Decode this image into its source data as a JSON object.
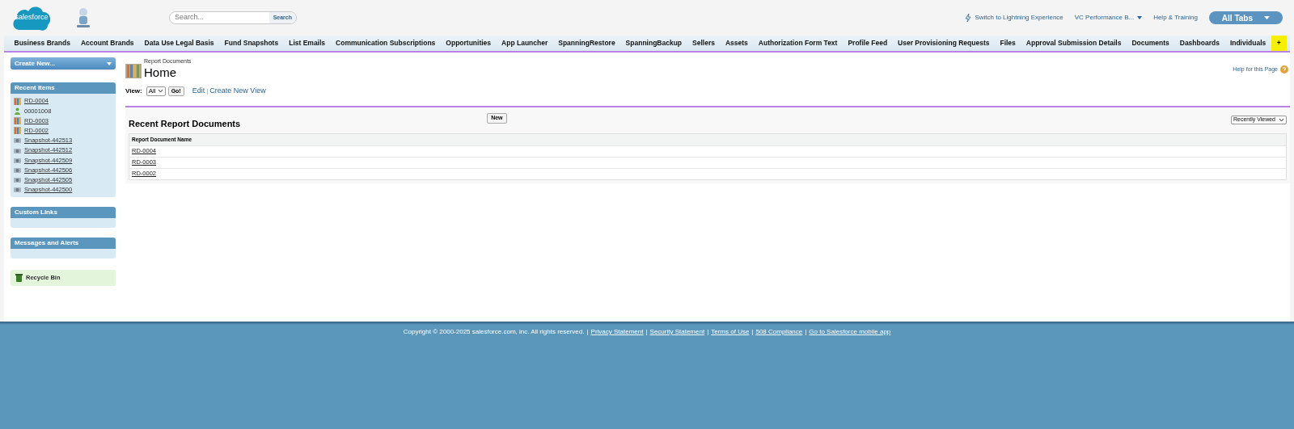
{
  "header": {
    "logo": "salesforce",
    "search": {
      "placeholder": "Search...",
      "button": "Search"
    },
    "links": [
      {
        "label": "Switch to Lightning Experience",
        "kind": "lightning"
      },
      {
        "label": "VC Performance B...",
        "kind": "menu"
      },
      {
        "label": "Help & Training",
        "kind": "plain"
      }
    ],
    "all_tabs": "All Tabs"
  },
  "tabs": [
    {
      "label": "Business Brands",
      "highlighted": false
    },
    {
      "label": "Account Brands",
      "highlighted": false
    },
    {
      "label": "Data Use Legal Basis",
      "highlighted": false
    },
    {
      "label": "Fund Snapshots",
      "highlighted": false
    },
    {
      "label": "List Emails",
      "highlighted": false
    },
    {
      "label": "Communication Subscriptions",
      "highlighted": false
    },
    {
      "label": "Opportunities",
      "highlighted": false
    },
    {
      "label": "App Launcher",
      "highlighted": false
    },
    {
      "label": "SpanningRestore",
      "highlighted": false
    },
    {
      "label": "SpanningBackup",
      "highlighted": false
    },
    {
      "label": "Sellers",
      "highlighted": false
    },
    {
      "label": "Assets",
      "highlighted": false
    },
    {
      "label": "Authorization Form Text",
      "highlighted": false
    },
    {
      "label": "Profile Feed",
      "highlighted": false
    },
    {
      "label": "User Provisioning Requests",
      "highlighted": false
    },
    {
      "label": "Files",
      "highlighted": false
    },
    {
      "label": "Approval Submission Details",
      "highlighted": false
    },
    {
      "label": "Documents",
      "highlighted": false
    },
    {
      "label": "Dashboards",
      "highlighted": false
    },
    {
      "label": "Individuals",
      "highlighted": false
    },
    {
      "label": "+",
      "highlighted": true
    }
  ],
  "sidebar": {
    "create_new": "Create New...",
    "recent_items": {
      "title": "Recent Items",
      "items": [
        {
          "label": "RD-0004",
          "kind": "report"
        },
        {
          "label": "00001008",
          "kind": "person"
        },
        {
          "label": "RD-0003",
          "kind": "report"
        },
        {
          "label": "RD-0002",
          "kind": "report"
        },
        {
          "label": "Snapshot-442513",
          "kind": "snapshot"
        },
        {
          "label": "Snapshot-442512",
          "kind": "snapshot"
        },
        {
          "label": "Snapshot-442509",
          "kind": "snapshot"
        },
        {
          "label": "Snapshot-442506",
          "kind": "snapshot"
        },
        {
          "label": "Snapshot-442505",
          "kind": "snapshot"
        },
        {
          "label": "Snapshot-442500",
          "kind": "snapshot"
        }
      ]
    },
    "sections": [
      "Custom Links",
      "Messages and Alerts"
    ],
    "recycle_bin": "Recycle Bin"
  },
  "page": {
    "object": "Report Documents",
    "title": "Home",
    "help": "Help for this Page",
    "view_label": "View:",
    "view_value": "All",
    "go": "Go!",
    "edit": "Edit",
    "separator": "|",
    "create_view": "Create New View"
  },
  "list": {
    "title": "Recent Report Documents",
    "new_button": "New",
    "filter": "Recently Viewed",
    "column": "Report Document Name",
    "rows": [
      "RD-0004",
      "RD-0003",
      "RD-0002"
    ]
  },
  "footer": {
    "separator": "|",
    "copyright": "Copyright © 2000-2025 salesforce.com, inc. All rights reserved.",
    "links": [
      "Privacy Statement",
      "Security Statement",
      "Terms of Use",
      "508 Compliance",
      "Go to Salesforce mobile app"
    ]
  }
}
